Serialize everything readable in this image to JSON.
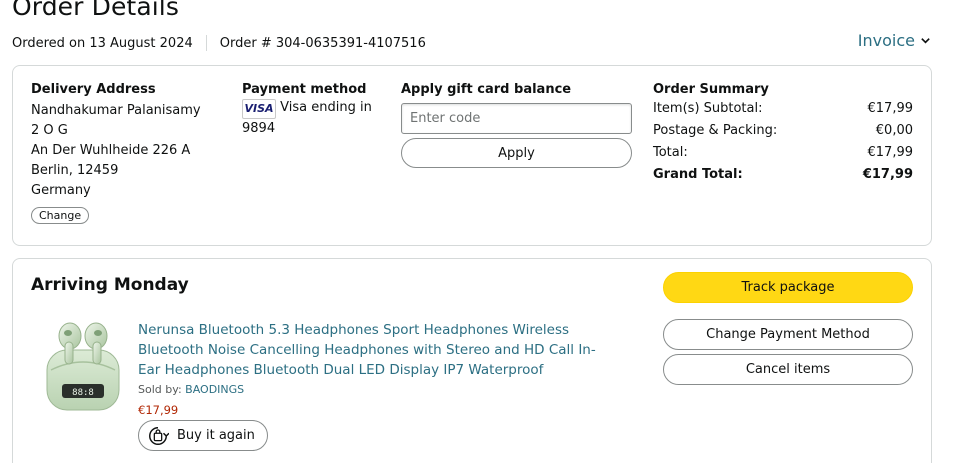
{
  "header": {
    "title": "Order Details",
    "ordered_on": "Ordered on 13 August 2024",
    "order_number": "Order # 304-0635391-4107516",
    "invoice_label": "Invoice"
  },
  "delivery": {
    "heading": "Delivery Address",
    "lines": [
      "Nandhakumar Palanisamy",
      "2 O G",
      "An Der Wuhlheide 226 A",
      "Berlin, 12459",
      "Germany"
    ],
    "change_label": "Change"
  },
  "payment": {
    "heading": "Payment method",
    "card_brand": "VISA",
    "card_text": "Visa ending in 9894"
  },
  "gift_card": {
    "heading": "Apply gift card balance",
    "placeholder": "Enter code",
    "value": "",
    "apply_label": "Apply"
  },
  "summary": {
    "heading": "Order Summary",
    "rows": [
      {
        "label": "Item(s) Subtotal:",
        "value": "€17,99"
      },
      {
        "label": "Postage & Packing:",
        "value": "€0,00"
      },
      {
        "label": "Total:",
        "value": "€17,99"
      },
      {
        "label": "Grand Total:",
        "value": "€17,99"
      }
    ]
  },
  "shipment": {
    "status": "Arriving Monday",
    "product_title": "Nerunsa Bluetooth 5.3 Headphones Sport Headphones Wireless Bluetooth Noise Cancelling Headphones with Stereo and HD Call In-Ear Headphones Bluetooth Dual LED Display IP7 Waterproof",
    "sold_by_label": "Sold by:",
    "seller": "BAODINGS",
    "price": "€17,99",
    "buy_again_label": "Buy it again",
    "display_text": "88:8",
    "actions": {
      "track": "Track package",
      "change_payment": "Change Payment Method",
      "cancel": "Cancel items"
    }
  },
  "colors": {
    "link": "#2c6f83",
    "price": "#b12704",
    "track_button": "#ffd814",
    "border": "#d5d9d9"
  }
}
